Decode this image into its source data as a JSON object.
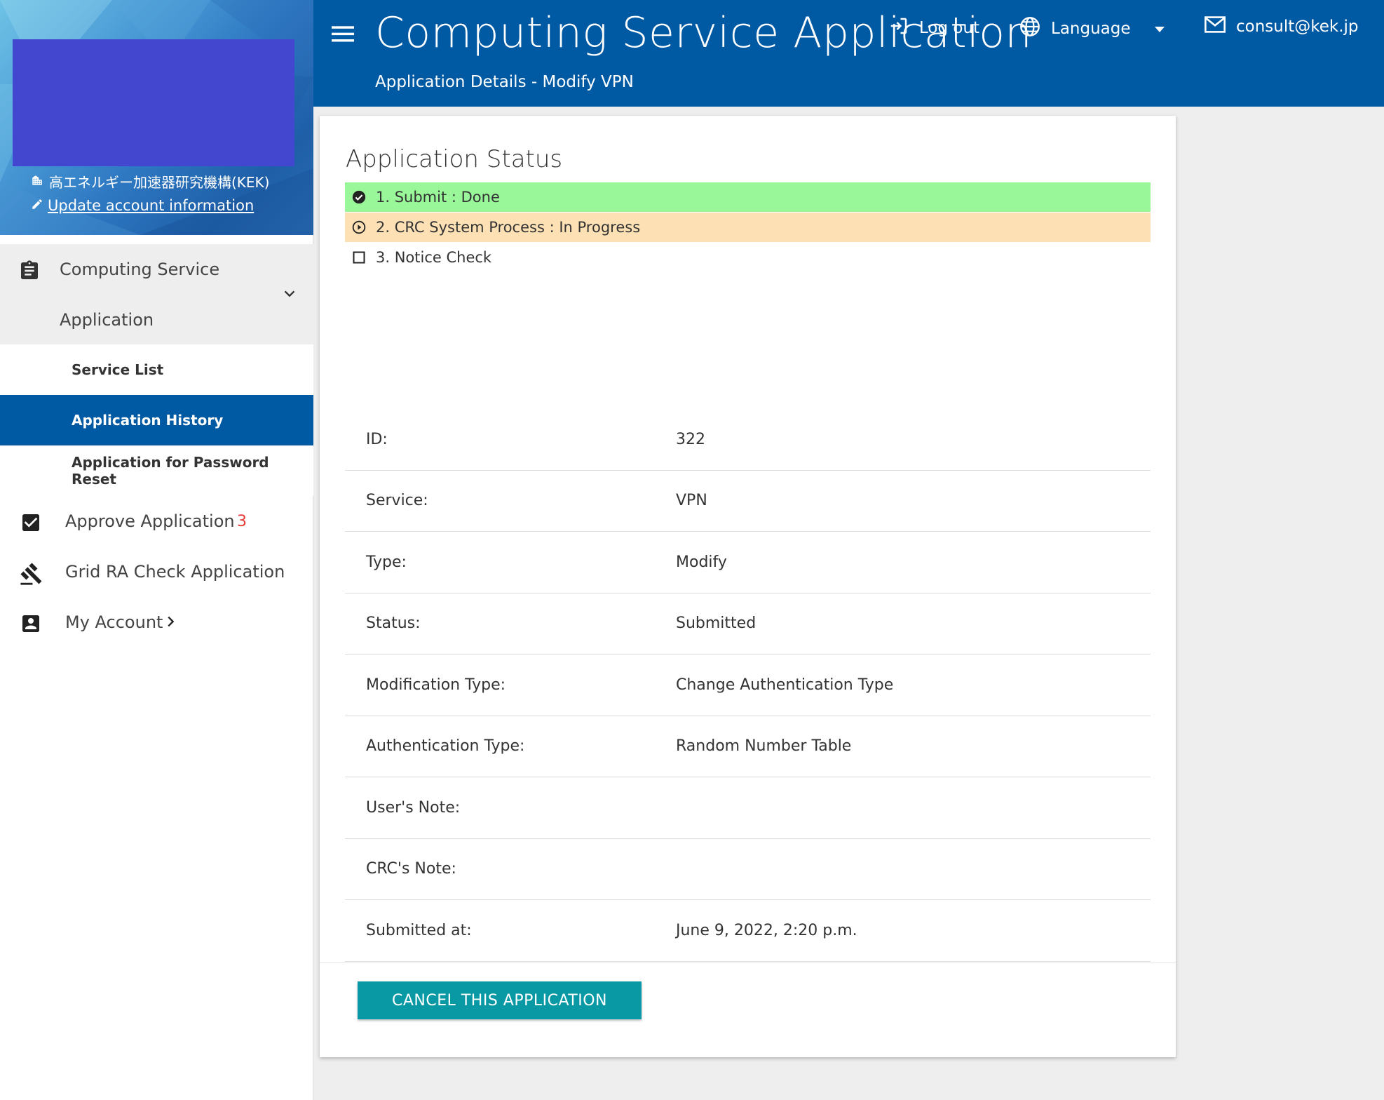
{
  "sidebar": {
    "organization": "高エネルギー加速器研究機構(KEK)",
    "update_link": "Update account information",
    "group": {
      "label_line1": "Computing Service",
      "label_line2": "Application"
    },
    "sub_items": [
      "Service List",
      "Application History",
      "Application for Password Reset"
    ],
    "active_sub_item": "Application History",
    "approve": {
      "label": "Approve Application",
      "badge": "3"
    },
    "grid_ra": {
      "label": "Grid RA Check Application"
    },
    "my_account": {
      "label": "My Account"
    }
  },
  "header": {
    "title": "Computing Service Application",
    "subtitle": "Application Details - Modify VPN",
    "logout": "Log out",
    "language": "Language",
    "email": "consult@kek.jp"
  },
  "status": {
    "title": "Application Status",
    "steps": [
      {
        "label": "1. Submit : Done",
        "state": "done",
        "color": "#99f79a"
      },
      {
        "label": "2. CRC System Process : In Progress",
        "state": "in-progress",
        "color": "#fde1b5"
      },
      {
        "label": "3. Notice Check",
        "state": "pending",
        "color": "#ffffff"
      }
    ]
  },
  "details": {
    "id": {
      "label": "ID:",
      "value": "322"
    },
    "service": {
      "label": "Service:",
      "value": "VPN"
    },
    "type": {
      "label": "Type:",
      "value": "Modify"
    },
    "status": {
      "label": "Status:",
      "value": "Submitted"
    },
    "modification_type": {
      "label": "Modification Type:",
      "value": "Change Authentication Type"
    },
    "authentication_type": {
      "label": "Authentication Type:",
      "value": "Random Number Table"
    },
    "users_note": {
      "label": "User's Note:",
      "value": ""
    },
    "crcs_note": {
      "label": "CRC's Note:",
      "value": ""
    },
    "submitted_at": {
      "label": "Submitted at:",
      "value": "June 9, 2022, 2:20 p.m."
    }
  },
  "actions": {
    "cancel": "CANCEL THIS APPLICATION"
  },
  "colors": {
    "primary": "#0059a3",
    "accent": "#0899a5",
    "badge": "#e53935",
    "avatar_block": "#4347cf"
  }
}
